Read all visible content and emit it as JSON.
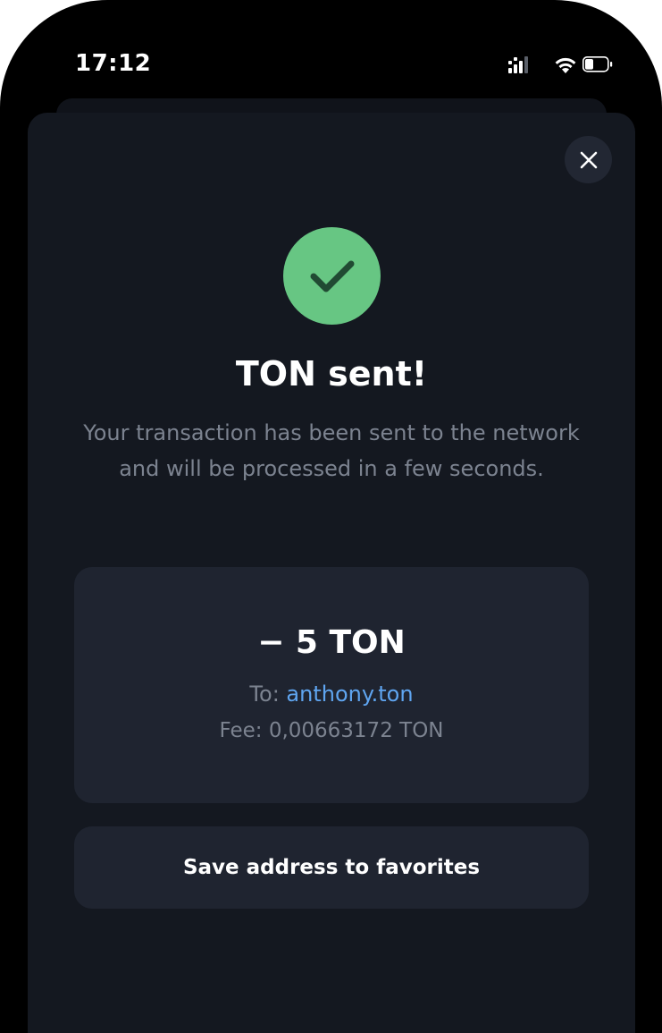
{
  "status_bar": {
    "time": "17:12"
  },
  "modal": {
    "close_icon": "close-icon",
    "success_icon": "checkmark-icon",
    "title": "TON sent!",
    "subtitle": "Your transaction has been sent to the network and will be processed in a few seconds."
  },
  "summary": {
    "amount": "− 5 TON",
    "to_label": "To:",
    "to_address": "anthony.ton",
    "fee": "Fee: 0,00663172 TON"
  },
  "actions": {
    "save_label": "Save address to favorites"
  },
  "colors": {
    "background": "#000000",
    "sheet": "#141820",
    "card": "#1f2430",
    "success": "#67c683",
    "link": "#5fa5f0",
    "muted_text": "#7c8390"
  }
}
